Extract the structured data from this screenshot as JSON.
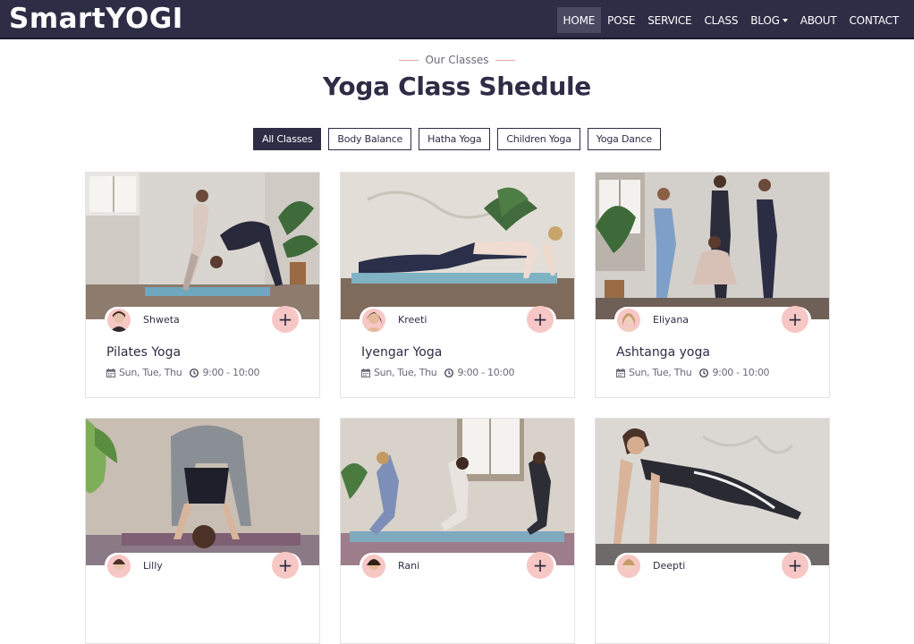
{
  "brand": "SmartYOGI",
  "nav": [
    {
      "label": "HOME",
      "active": true
    },
    {
      "label": "POSE"
    },
    {
      "label": "SERVICE"
    },
    {
      "label": "CLASS"
    },
    {
      "label": "BLOG",
      "dropdown": true
    },
    {
      "label": "ABOUT"
    },
    {
      "label": "CONTACT"
    }
  ],
  "section": {
    "eyebrow": "Our Classes",
    "title": "Yoga Class Shedule"
  },
  "filters": [
    "All Classes",
    "Body Balance",
    "Hatha Yoga",
    "Children Yoga",
    "Yoga Dance"
  ],
  "cards": [
    {
      "instructor": "Shweta",
      "name": "Pilates Yoga",
      "days": "Sun, Tue, Thu",
      "time": "9:00 - 10:00"
    },
    {
      "instructor": "Kreeti",
      "name": "Iyengar Yoga",
      "days": "Sun, Tue, Thu",
      "time": "9:00 - 10:00"
    },
    {
      "instructor": "Eliyana",
      "name": "Ashtanga yoga",
      "days": "Sun, Tue, Thu",
      "time": "9:00 - 10:00"
    },
    {
      "instructor": "Lilly",
      "name": "",
      "days": "",
      "time": ""
    },
    {
      "instructor": "Rani",
      "name": "",
      "days": "",
      "time": ""
    },
    {
      "instructor": "Deepti",
      "name": "",
      "days": "",
      "time": ""
    }
  ],
  "icons": {
    "plus": "+",
    "calendar": "calendar-icon",
    "clock": "clock-icon"
  },
  "colors": {
    "nav_bg": "#2f2c45",
    "accent_pink": "#f6c7c4",
    "text_dark": "#2f2c45"
  }
}
